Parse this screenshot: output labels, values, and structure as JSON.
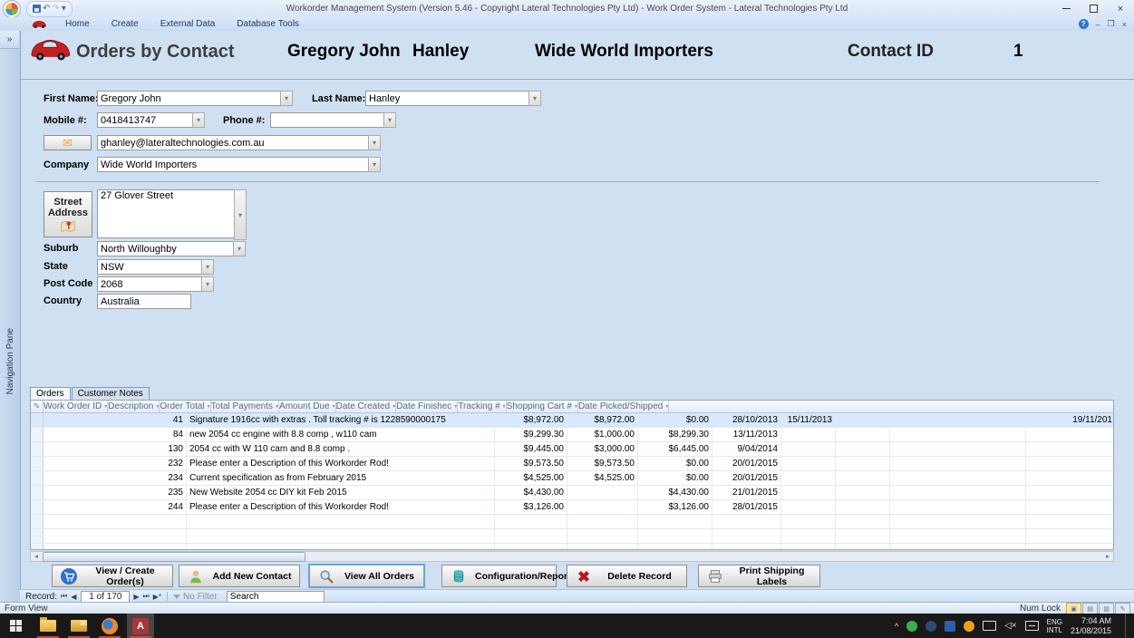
{
  "window": {
    "title": "Workorder Management System (Version 5.46 - Copyright Lateral Technologies Pty Ltd) - Work Order System - Lateral Technologies Pty Ltd"
  },
  "ribbon": {
    "tabs": [
      "Home",
      "Create",
      "External Data",
      "Database Tools"
    ]
  },
  "icons": {
    "combo_arrow": "▾",
    "sort_arrow": "▾",
    "nav_pane_chevron": "»",
    "email": "✉",
    "selector_pencil": "✎",
    "help": "?",
    "undo": "↶",
    "redo": "↷",
    "qat_dropdown": "▾",
    "scroll_left": "◂",
    "scroll_right": "▸",
    "tray_chevron": "^",
    "speaker_muted": "🔇"
  },
  "nav_pane": {
    "label": "Navigation Pane"
  },
  "header": {
    "form_title": "Orders by Contact",
    "first_name": "Gregory John",
    "last_name": "Hanley",
    "company": "Wide World Importers",
    "contact_id_label": "Contact ID",
    "contact_id": "1"
  },
  "form": {
    "first_name": {
      "label": "First Name:",
      "value": "Gregory John"
    },
    "last_name": {
      "label": "Last Name:",
      "value": "Hanley"
    },
    "mobile": {
      "label": "Mobile #:",
      "value": "0418413747"
    },
    "phone": {
      "label": "Phone #:",
      "value": ""
    },
    "email": {
      "value": "ghanley@lateraltechnologies.com.au"
    },
    "company": {
      "label": "Company",
      "value": "Wide World Importers"
    },
    "street_address": {
      "label_line1": "Street",
      "label_line2": "Address",
      "value": "27 Glover Street"
    },
    "suburb": {
      "label": "Suburb",
      "value": "North Willoughby"
    },
    "state": {
      "label": "State",
      "value": "NSW"
    },
    "post_code": {
      "label": "Post Code",
      "value": "2068"
    },
    "country": {
      "label": "Country",
      "value": "Australia"
    }
  },
  "subform_tabs": {
    "orders": "Orders",
    "customer_notes": "Customer Notes"
  },
  "orders_table": {
    "columns": [
      "Work Order ID",
      "Description",
      "Order Total",
      "Total Payments",
      "Amount Due",
      "Date Created",
      "Date Finishec",
      "Tracking #",
      "Shopping Cart #",
      "Date Picked/Shipped"
    ],
    "rows": [
      {
        "id": "41",
        "description": "Signature 1916cc with extras . Toll tracking # is 1228590000175",
        "order_total": "$8,972.00",
        "total_payments": "$8,972.00",
        "amount_due": "$0.00",
        "date_created": "28/10/2013",
        "date_finished": "15/11/2013",
        "tracking": "",
        "shopping_cart": "",
        "date_shipped": "19/11/201"
      },
      {
        "id": "84",
        "description": "new 2054 cc engine with 8.8 comp , w110 cam",
        "order_total": "$9,299.30",
        "total_payments": "$1,000.00",
        "amount_due": "$8,299.30",
        "date_created": "13/11/2013",
        "date_finished": "",
        "tracking": "",
        "shopping_cart": "",
        "date_shipped": ""
      },
      {
        "id": "130",
        "description": "2054 cc with W 110 cam and 8.8 comp .",
        "order_total": "$9,445.00",
        "total_payments": "$3,000.00",
        "amount_due": "$6,445.00",
        "date_created": "9/04/2014",
        "date_finished": "",
        "tracking": "",
        "shopping_cart": "",
        "date_shipped": ""
      },
      {
        "id": "232",
        "description": "Please enter a Description of this Workorder Rod!",
        "order_total": "$9,573.50",
        "total_payments": "$9,573.50",
        "amount_due": "$0.00",
        "date_created": "20/01/2015",
        "date_finished": "",
        "tracking": "",
        "shopping_cart": "",
        "date_shipped": ""
      },
      {
        "id": "234",
        "description": "Current specification as from February 2015",
        "order_total": "$4,525.00",
        "total_payments": "$4,525.00",
        "amount_due": "$0.00",
        "date_created": "20/01/2015",
        "date_finished": "",
        "tracking": "",
        "shopping_cart": "",
        "date_shipped": ""
      },
      {
        "id": "235",
        "description": "New Website 2054 cc DIY kit Feb 2015",
        "order_total": "$4,430.00",
        "total_payments": "",
        "amount_due": "$4,430.00",
        "date_created": "21/01/2015",
        "date_finished": "",
        "tracking": "",
        "shopping_cart": "",
        "date_shipped": ""
      },
      {
        "id": "244",
        "description": "Please enter a Description of this Workorder Rod!",
        "order_total": "$3,126.00",
        "total_payments": "",
        "amount_due": "$3,126.00",
        "date_created": "28/01/2015",
        "date_finished": "",
        "tracking": "",
        "shopping_cart": "",
        "date_shipped": ""
      }
    ]
  },
  "action_buttons": {
    "view_create_orders": "View / Create Order(s)",
    "add_new_contact": "Add New Contact",
    "view_all_orders": "View All Orders",
    "configuration_reports": "Configuration/Reports",
    "delete_record": "Delete Record",
    "print_shipping_labels": "Print Shipping Labels"
  },
  "record_nav": {
    "label": "Record:",
    "first": "⏮",
    "prev": "◀",
    "position": "1 of 170",
    "next": "▶",
    "last": "⏭",
    "new_record": "▶*",
    "no_filter": "No Filter",
    "search_text": "Search"
  },
  "status_bar": {
    "view_mode": "Form View",
    "num_lock": "Num Lock"
  },
  "taskbar": {
    "lang_line1": "ENG",
    "lang_line2": "INTL",
    "time": "7:04 AM",
    "date": "21/08/2015"
  }
}
